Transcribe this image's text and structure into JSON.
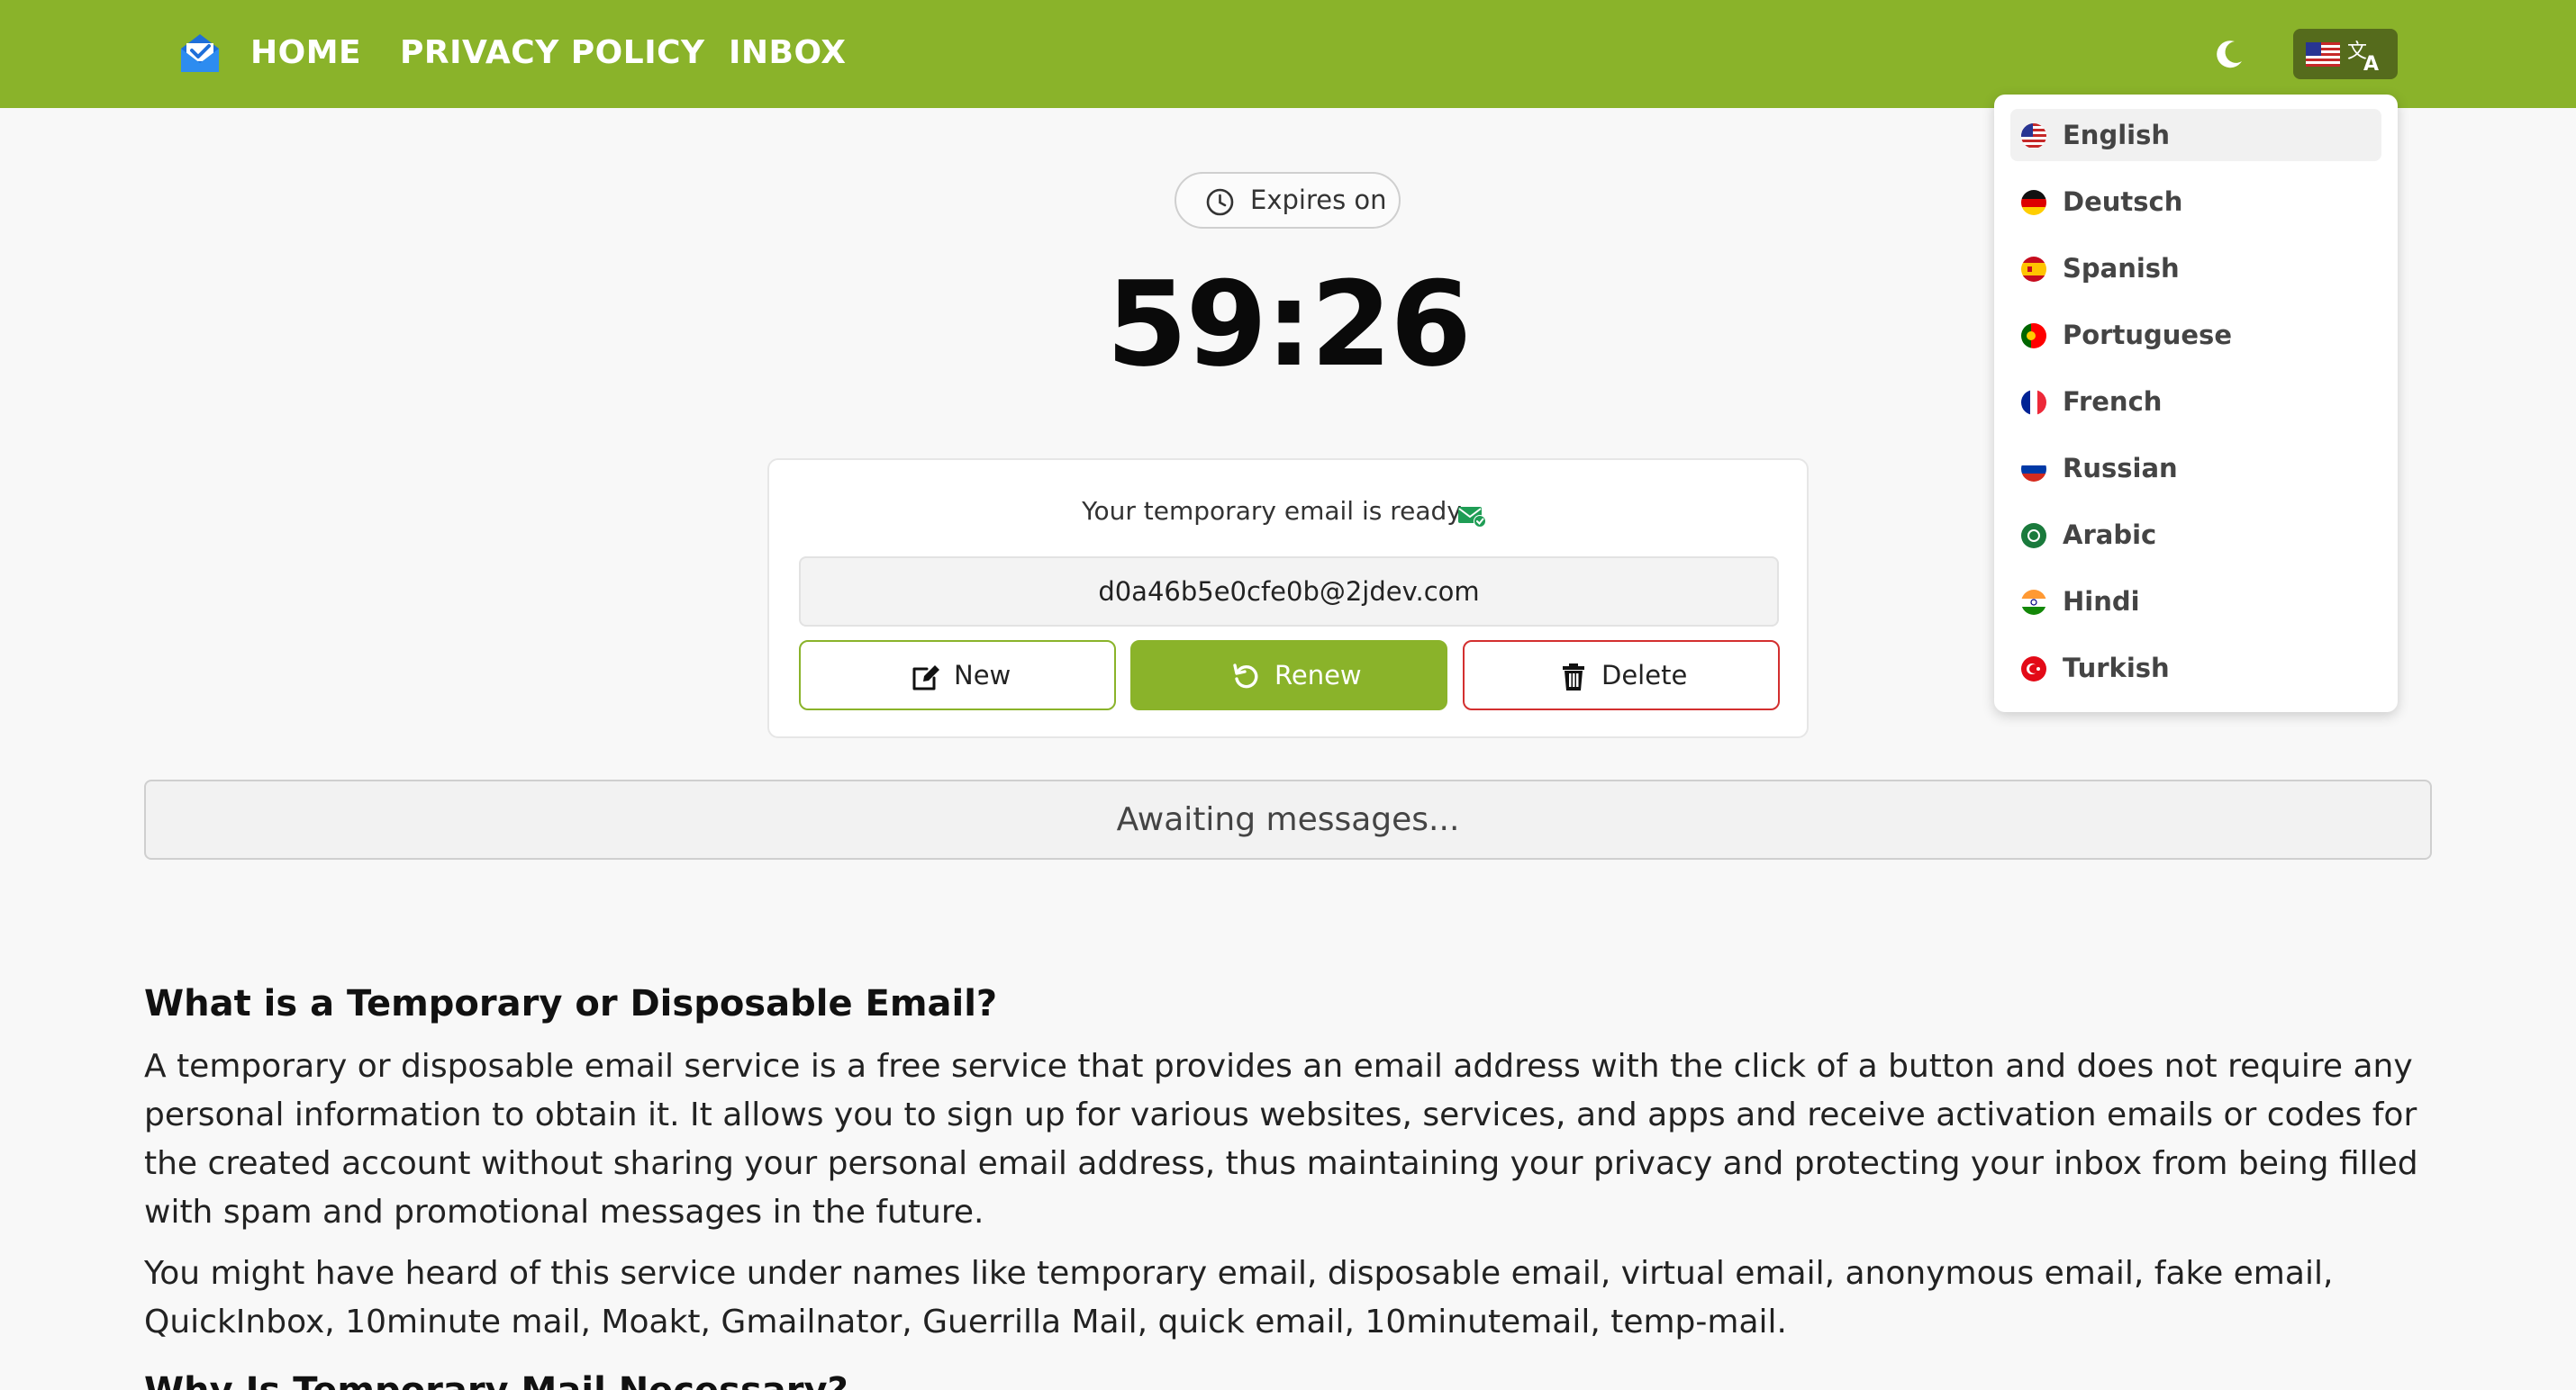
{
  "nav": {
    "home": "HOME",
    "privacy": "PRIVACY POLICY",
    "inbox": "INBOX"
  },
  "colors": {
    "brand": "#8ab32a",
    "delete": "#d32f2f"
  },
  "languages": {
    "selected": "English",
    "items": [
      {
        "label": "English",
        "icon": "us-flag-icon"
      },
      {
        "label": "Deutsch",
        "icon": "de-flag-icon"
      },
      {
        "label": "Spanish",
        "icon": "es-flag-icon"
      },
      {
        "label": "Portuguese",
        "icon": "pt-flag-icon"
      },
      {
        "label": "French",
        "icon": "fr-flag-icon"
      },
      {
        "label": "Russian",
        "icon": "ru-flag-icon"
      },
      {
        "label": "Arabic",
        "icon": "sa-flag-icon"
      },
      {
        "label": "Hindi",
        "icon": "in-flag-icon"
      },
      {
        "label": "Turkish",
        "icon": "tr-flag-icon"
      }
    ]
  },
  "timer": {
    "expires_label": "Expires on",
    "value": "59:26"
  },
  "email": {
    "ready_text": "Your temporary email is ready",
    "address": "d0a46b5e0cfe0b@2jdev.com",
    "new_label": "New",
    "renew_label": "Renew",
    "delete_label": "Delete"
  },
  "inbox": {
    "status": "Awaiting messages..."
  },
  "content": {
    "heading": "What is a Temporary or Disposable Email?",
    "para1": "A temporary or disposable email service is a free service that provides an email address with the click of a button and does not require any personal information to obtain it. It allows you to sign up for various websites, services, and apps and receive activation emails or codes for the created account without sharing your personal email address, thus maintaining your privacy and protecting your inbox from being filled with spam and promotional messages in the future.",
    "para2": "You might have heard of this service under names like temporary email, disposable email, virtual email, anonymous email, fake email, QuickInbox, 10minute mail, Moakt, Gmailnator, Guerrilla Mail, quick email, 10minutemail, temp-mail.",
    "heading2": "Why Is Temporary Mail Necessary?"
  }
}
